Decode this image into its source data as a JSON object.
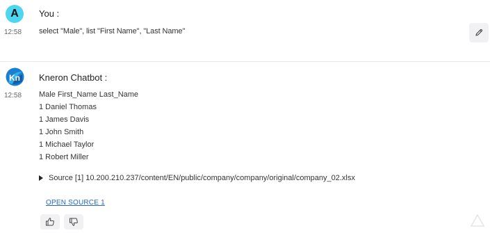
{
  "user_message": {
    "avatar_letter": "A",
    "sender": "You :",
    "time": "12:58",
    "text": "select \"Male\", list \"First Name\", \"Last Name\""
  },
  "bot_message": {
    "sender": "Kneron Chatbot :",
    "time": "12:58",
    "lines": [
      "Male First_Name Last_Name",
      "1 Daniel Thomas",
      "1 James Davis",
      "1 John Smith",
      "1 Michael Taylor",
      "1 Robert Miller"
    ],
    "source_text": "Source [1] 10.200.210.237/content/EN/public/company/company/original/company_02.xlsx",
    "open_source_label": "OPEN SOURCE 1"
  },
  "icons": {
    "edit": "pencil-icon",
    "thumb_up": "thumbs-up-icon",
    "thumb_down": "thumbs-down-icon",
    "bot_avatar": "kneron-logo-icon"
  },
  "colors": {
    "avatar_user_bg": "#4dd6f0",
    "link": "#2468c7",
    "button_bg": "#f1f1f3"
  }
}
